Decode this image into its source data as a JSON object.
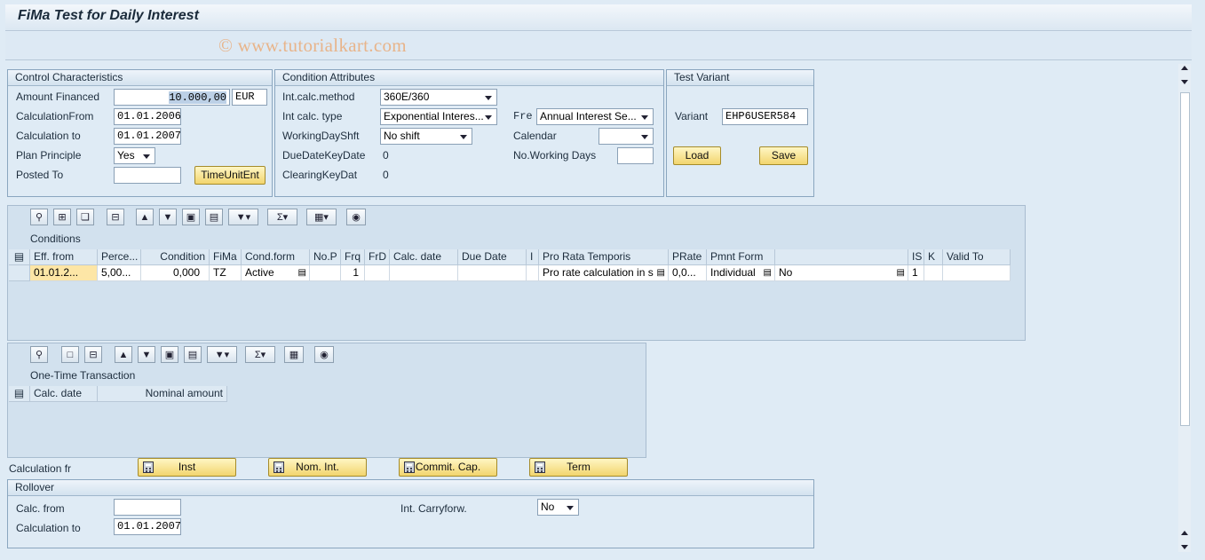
{
  "header": {
    "title": "FiMa Test for Daily Interest",
    "watermark": "© www.tutorialkart.com"
  },
  "control": {
    "title": "Control Characteristics",
    "amount_label": "Amount Financed",
    "amount_value": "10.000,00",
    "currency": "EUR",
    "calc_from_label": "CalculationFrom",
    "calc_from_value": "01.01.2006",
    "calc_to_label": "Calculation to",
    "calc_to_value": "01.01.2007",
    "plan_label": "Plan Principle",
    "plan_value": "Yes",
    "posted_label": "Posted To",
    "posted_value": "",
    "timeunit_button": "TimeUnitEnt"
  },
  "condition": {
    "title": "Condition Attributes",
    "method_label": "Int.calc.method",
    "method_value": "360E/360",
    "type_label": "Int calc. type",
    "type_value": "Exponential Interes...",
    "shift_label": "WorkingDayShft",
    "shift_value": "No shift",
    "due_label": "DueDateKeyDate",
    "due_value": "0",
    "clearing_label": "ClearingKeyDat",
    "clearing_value": "0",
    "fre_label": "Fre",
    "fre_value": "Annual Interest Se...",
    "calendar_label": "Calendar",
    "calendar_value": "",
    "workdays_label": "No.Working Days",
    "workdays_value": ""
  },
  "variant": {
    "title": "Test Variant",
    "variant_label": "Variant",
    "variant_value": "EHP6USER584",
    "load_button": "Load",
    "save_button": "Save"
  },
  "conditions_table": {
    "title": "Conditions",
    "columns": [
      "Eff. from",
      "Perce...",
      "Condition",
      "FiMa",
      "Cond.form",
      "No.P",
      "Frq",
      "FrD",
      "Calc. date",
      "Due Date",
      "I",
      "Pro Rata Temporis",
      "PRate",
      "Pmnt Form",
      "",
      "IS",
      "K",
      "Valid To"
    ],
    "row": [
      "01.01.2...",
      "5,00...",
      "0,000",
      "TZ",
      "Active",
      "",
      "1",
      "",
      "",
      "",
      "",
      "Pro rate calculation in s",
      "0,0...",
      "Individual",
      "No",
      "1",
      "",
      ""
    ]
  },
  "onetime_table": {
    "title": "One-Time Transaction",
    "columns": [
      "Calc. date",
      "Nominal amount"
    ]
  },
  "calc_buttons": {
    "label": "Calculation fr",
    "inst": "Inst",
    "nomint": "Nom. Int.",
    "commit": "Commit. Cap.",
    "term": "Term"
  },
  "rollover": {
    "title": "Rollover",
    "calc_from_label": "Calc. from",
    "calc_from_value": "",
    "calc_to_label": "Calculation to",
    "calc_to_value": "01.01.2007",
    "carry_label": "Int. Carryforw.",
    "carry_value": "No"
  },
  "colors": {
    "background": "#dfebf5",
    "button": "#f2d56e",
    "highlight_cell": "#fde6a6",
    "watermark": "#e8b48a"
  },
  "icons": [
    "details-icon",
    "insert-row-icon",
    "copy-icon",
    "delete-row-icon",
    "print-icon",
    "filter-icon",
    "find-icon",
    "find-next-icon",
    "set-filter-icon",
    "sum-icon",
    "layout-icon",
    "chart-icon",
    "calculator-icon"
  ]
}
